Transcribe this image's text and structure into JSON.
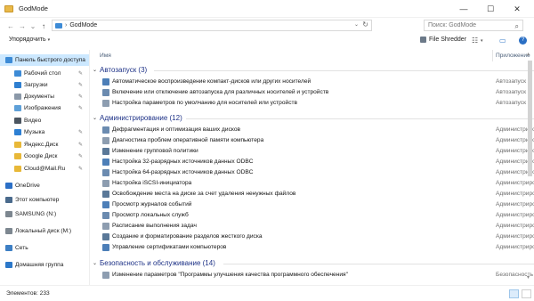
{
  "window": {
    "title": "GodMode",
    "minimize_glyph": "—",
    "maximize_glyph": "☐",
    "close_glyph": "✕"
  },
  "nav_buttons": {
    "back": "←",
    "forward": "→",
    "recent": "⌄",
    "up": "↑"
  },
  "address": {
    "separator": "›",
    "path": "GodMode",
    "dropdown_glyph": "⌄",
    "refresh_glyph": "↻"
  },
  "search": {
    "placeholder": "Поиск: GodMode",
    "icon_glyph": "⌕"
  },
  "toolbar": {
    "organize_label": "Упорядочить",
    "organize_caret": "▾",
    "shredder_label": "File Shredder",
    "view_glyph": "☷",
    "view_caret": "▾",
    "pane_glyph": "▭",
    "help_glyph": "?"
  },
  "navigation": [
    {
      "label": "Панель быстрого доступа",
      "icon": "star-icon",
      "color": "#3d8bd6",
      "pinned": false,
      "selected": true,
      "indent": 1
    },
    {
      "label": "Рабочий стол",
      "icon": "desktop-icon",
      "color": "#3d8bd6",
      "pinned": true,
      "selected": false,
      "indent": 2
    },
    {
      "label": "Загрузки",
      "icon": "download-icon",
      "color": "#2f7fd0",
      "pinned": true,
      "selected": false,
      "indent": 2
    },
    {
      "label": "Документы",
      "icon": "documents-icon",
      "color": "#8a98a8",
      "pinned": true,
      "selected": false,
      "indent": 2
    },
    {
      "label": "Изображения",
      "icon": "pictures-icon",
      "color": "#5ea0d8",
      "pinned": true,
      "selected": false,
      "indent": 2
    },
    {
      "label": "Видео",
      "icon": "video-icon",
      "color": "#4b5560",
      "pinned": false,
      "selected": false,
      "indent": 2
    },
    {
      "label": "Музыка",
      "icon": "music-icon",
      "color": "#2d7fd3",
      "pinned": true,
      "selected": false,
      "indent": 2
    },
    {
      "label": "Яндекс.Диск",
      "icon": "yandex-disk-icon",
      "color": "#e8b838",
      "pinned": true,
      "selected": false,
      "indent": 2
    },
    {
      "label": "Google Диск",
      "icon": "google-drive-icon",
      "color": "#e8b838",
      "pinned": true,
      "selected": false,
      "indent": 2
    },
    {
      "label": "Cloud@Mail.Ru",
      "icon": "cloud-mailru-icon",
      "color": "#e8b838",
      "pinned": true,
      "selected": false,
      "indent": 2
    },
    {
      "label": "OneDrive",
      "icon": "onedrive-icon",
      "color": "#2b6fc6",
      "pinned": false,
      "selected": false,
      "indent": 1
    },
    {
      "label": "Этот компьютер",
      "icon": "computer-icon",
      "color": "#4a6a8c",
      "pinned": false,
      "selected": false,
      "indent": 1
    },
    {
      "label": "SAMSUNG (N:)",
      "icon": "drive-icon",
      "color": "#7d8790",
      "pinned": false,
      "selected": false,
      "indent": 1
    },
    {
      "label": "Локальный диск (M:)",
      "icon": "drive-icon",
      "color": "#7d8790",
      "pinned": false,
      "selected": false,
      "indent": 1
    },
    {
      "label": "Сеть",
      "icon": "network-icon",
      "color": "#3d7fc4",
      "pinned": false,
      "selected": false,
      "indent": 1
    },
    {
      "label": "Домашняя группа",
      "icon": "homegroup-icon",
      "color": "#2c78c9",
      "pinned": false,
      "selected": false,
      "indent": 1
    }
  ],
  "pin_glyph": "✎",
  "columns": {
    "name": "Имя",
    "app": "Приложение"
  },
  "groups": [
    {
      "label": "Автозапуск (3)",
      "items": [
        {
          "name": "Автоматическое воспроизведение компакт-дисков или других носителей",
          "app": "Автозапуск"
        },
        {
          "name": "Включение или отключение автозапуска для различных носителей и устройств",
          "app": "Автозапуск"
        },
        {
          "name": "Настройка параметров по умолчанию для носителей или устройств",
          "app": "Автозапуск"
        }
      ]
    },
    {
      "label": "Администрирование (12)",
      "items": [
        {
          "name": "Дефрагментация и оптимизация ваших дисков",
          "app": "Администрирование"
        },
        {
          "name": "Диагностика проблем оперативной памяти компьютера",
          "app": "Администрирование"
        },
        {
          "name": "Изменение групповой политики",
          "app": "Администрирование"
        },
        {
          "name": "Настройка 32-разрядных источников данных ODBC",
          "app": "Администрирование"
        },
        {
          "name": "Настройка 64-разрядных источников данных ODBC",
          "app": "Администрирование"
        },
        {
          "name": "Настройка iSCSI-инициатора",
          "app": "Администрирование"
        },
        {
          "name": "Освобождение места на диске за счет удаления ненужных файлов",
          "app": "Администрирование"
        },
        {
          "name": "Просмотр журналов событий",
          "app": "Администрирование"
        },
        {
          "name": "Просмотр локальных служб",
          "app": "Администрирование"
        },
        {
          "name": "Расписание выполнения задач",
          "app": "Администрирование"
        },
        {
          "name": "Создание и форматирование разделов жесткого диска",
          "app": "Администрирование"
        },
        {
          "name": "Управление сертификатами компьютеров",
          "app": "Администрирование"
        }
      ]
    },
    {
      "label": "Безопасность и обслуживание (14)",
      "items": [
        {
          "name": "Изменение параметров \"Программы улучшения качества программного обеспечения\"",
          "app": "Безопасность и обслуживание"
        }
      ]
    }
  ],
  "group_caret": "⌄",
  "scroll": {
    "up": "▴",
    "down": "▾"
  },
  "status": {
    "count": "Элементов: 233"
  }
}
